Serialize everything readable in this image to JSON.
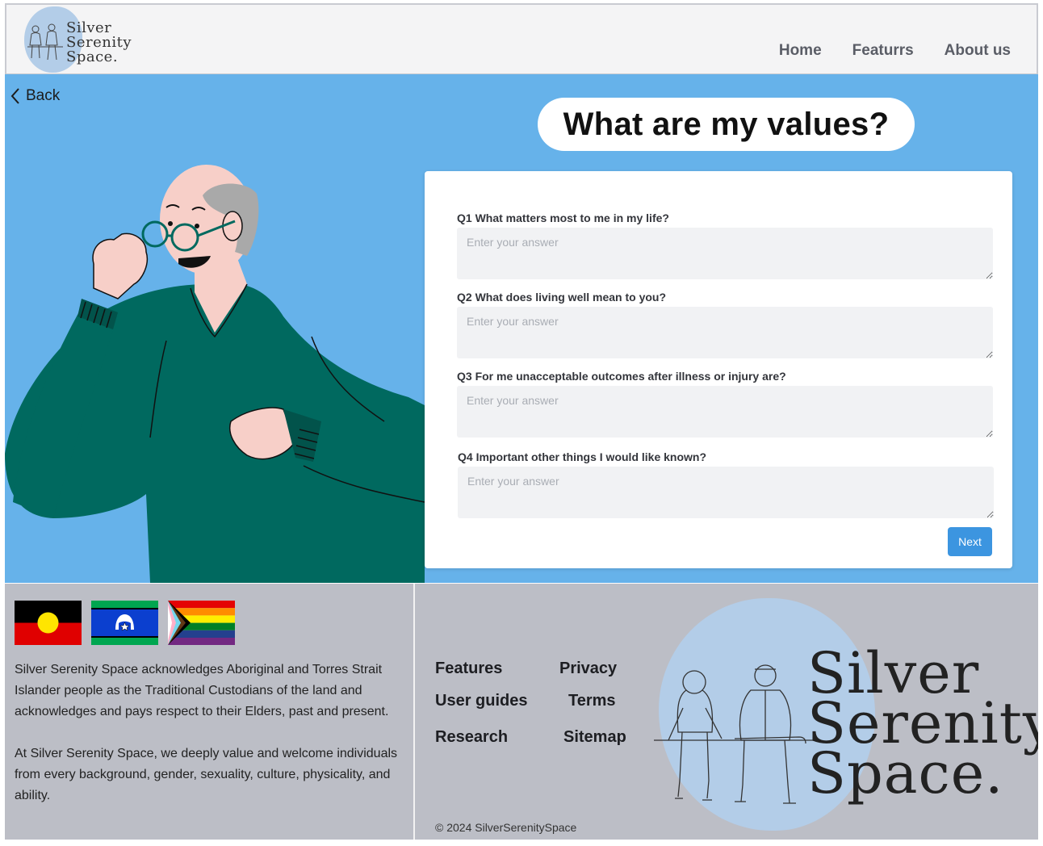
{
  "header": {
    "logo_lines": [
      "Silver",
      "Serenity",
      "Space."
    ],
    "nav": [
      "Home",
      "Featurrs",
      "About us"
    ]
  },
  "hero": {
    "back_label": "Back",
    "title": "What are my values?",
    "questions": [
      {
        "label": "Q1  What matters most to me in my life?",
        "placeholder": "Enter your answer"
      },
      {
        "label": "Q2 What does living well mean to you?",
        "placeholder": "Enter your answer"
      },
      {
        "label": "Q3 For me unacceptable outcomes after illness or injury are?",
        "placeholder": "Enter your answer"
      },
      {
        "label": "Q4 Important other things I would like known?",
        "placeholder": "Enter your answer"
      }
    ],
    "next_label": "Next"
  },
  "footer": {
    "acknowledgement": "Silver Serenity Space acknowledges Aboriginal and Torres Strait Islander people as the Traditional Custodians of the land  and acknowledges and pays respect to their Elders, past and present.",
    "welcome": "At Silver Serenity Space, we deeply value and welcome individuals from every background, gender, sexuality, culture, physicality, and ability.",
    "links": {
      "features": "Features",
      "privacy": "Privacy",
      "user_guides": "User guides",
      "terms": "Terms",
      "research": "Research",
      "sitemap": "Sitemap"
    },
    "copyright": "© 2024 SilverSerenitySpace",
    "logo_lines": [
      "Silver",
      "Serenity",
      "Space."
    ]
  },
  "colors": {
    "hero_bg": "#66b2ea",
    "footer_bg": "#bcbec6",
    "header_bg": "#f4f4f5",
    "button": "#3c95e0",
    "sweater": "#00695f",
    "logo_blob": "#b3cde8"
  }
}
